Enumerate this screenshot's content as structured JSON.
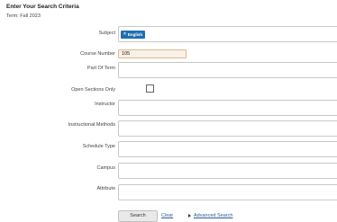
{
  "header": {
    "title": "Enter Your Search Criteria",
    "term": "Term: Fall 2023"
  },
  "form": {
    "subject": {
      "label": "Subject",
      "chips": [
        {
          "remove_glyph": "×",
          "text": "English"
        }
      ]
    },
    "course_number": {
      "label": "Course Number",
      "value": "105"
    },
    "part_of_term": {
      "label": "Part Of Term"
    },
    "open_sections_only": {
      "label": "Open Sections Only",
      "checked": false
    },
    "instructor": {
      "label": "Instructor"
    },
    "instructional_methods": {
      "label": "Instructional Methods"
    },
    "schedule_type": {
      "label": "Schedule Type"
    },
    "campus": {
      "label": "Campus"
    },
    "attribute": {
      "label": "Attribute"
    }
  },
  "actions": {
    "search_label": "Search",
    "clear_label": "Clear",
    "advanced_search_label": "Advanced Search"
  },
  "colors": {
    "chip_background": "#1f6fb2",
    "course_input_background": "#f7f1e7",
    "course_input_border": "#e0b98a",
    "link": "#2a5a9a"
  }
}
